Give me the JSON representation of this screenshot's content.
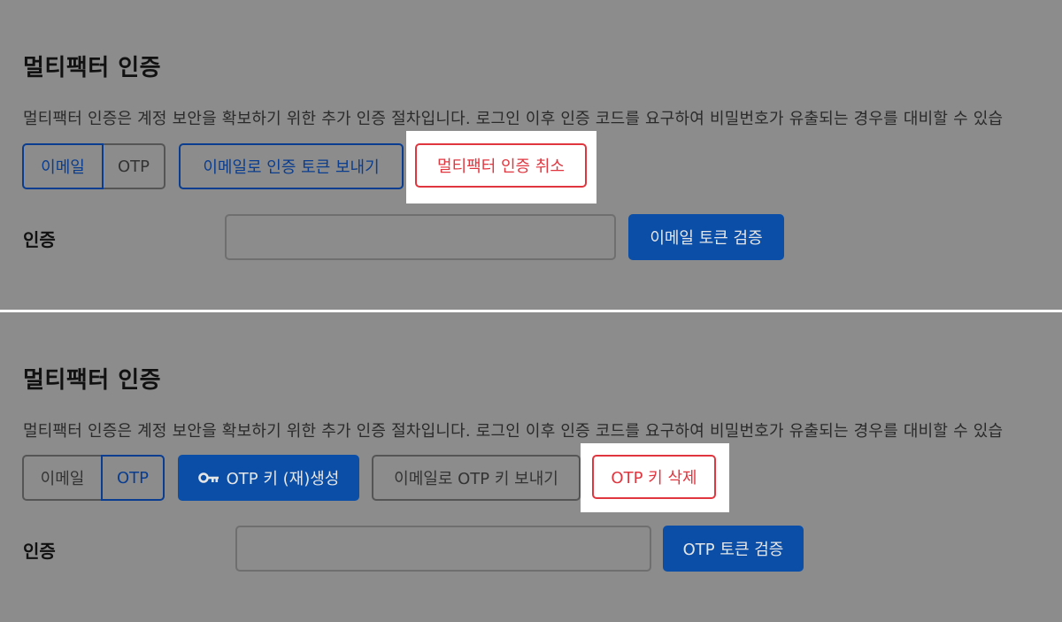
{
  "top": {
    "title": "멀티팩터 인증",
    "description": "멀티팩터 인증은 계정 보안을 확보하기 위한 추가 인증 절차입니다. 로그인 이후 인증 코드를 요구하여 비밀번호가 유출되는 경우를 대비할 수 있습",
    "tabs": {
      "email": "이메일",
      "otp": "OTP"
    },
    "send_email_token": "이메일로 인증 토큰 보내기",
    "cancel_mfa": "멀티팩터 인증 취소",
    "auth_label": "인증",
    "verify_button": "이메일 토큰 검증"
  },
  "bottom": {
    "title": "멀티팩터 인증",
    "description": "멀티팩터 인증은 계정 보안을 확보하기 위한 추가 인증 절차입니다. 로그인 이후 인증 코드를 요구하여 비밀번호가 유출되는 경우를 대비할 수 있습",
    "tabs": {
      "email": "이메일",
      "otp": "OTP"
    },
    "regenerate_key": "OTP 키 (재)생성",
    "send_otp_key_email": "이메일로 OTP 키 보내기",
    "delete_otp_key": "OTP 키 삭제",
    "auth_label": "인증",
    "verify_button": "OTP 토큰 검증"
  },
  "colors": {
    "primary": "#0a4ea8",
    "danger": "#e0363f",
    "overlay": "#8c8c8c"
  }
}
